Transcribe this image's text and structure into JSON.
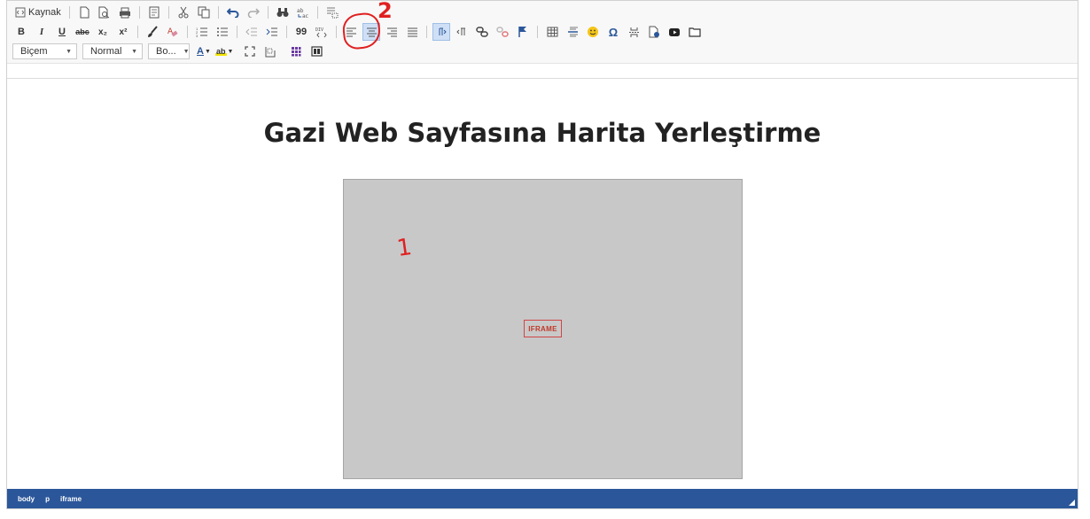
{
  "toolbar": {
    "source_label": "Kaynak",
    "format_combo": "Biçem",
    "paragraph_combo": "Normal",
    "font_size_combo": "Bo...",
    "bold_label": "B",
    "italic_label": "I",
    "underline_label": "U",
    "strike_label": "abc",
    "subscript_label": "x₂",
    "superscript_label": "x²",
    "text_color_label": "A",
    "bg_color_label": "ab",
    "blockquote_label": "99"
  },
  "content": {
    "heading": "Gazi Web Sayfasına Harita Yerleştirme",
    "iframe_placeholder": "IFRAME"
  },
  "statusbar": {
    "path": [
      "body",
      "p",
      "iframe"
    ]
  },
  "annotations": {
    "marker_1": "1",
    "marker_2": "2"
  },
  "colors": {
    "statusbar": "#2b579a",
    "annotation": "#e02020",
    "iframe_bg": "#c8c8c8",
    "active_button": "#cfe0f6"
  }
}
